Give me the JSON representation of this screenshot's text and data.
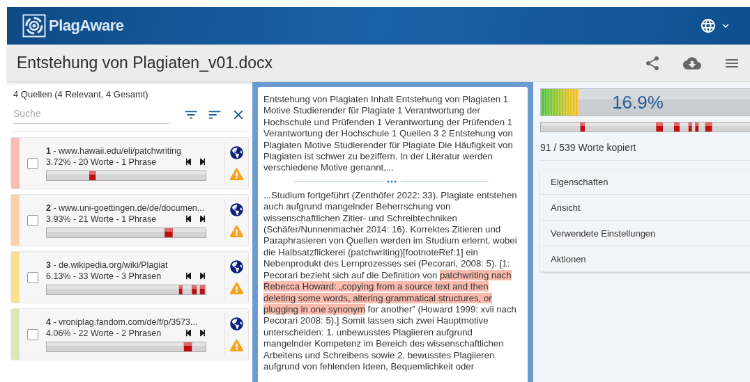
{
  "header": {
    "logo_text": "PlagAware"
  },
  "document": {
    "title": "Entstehung von Plagiaten_v01.docx"
  },
  "sources_panel": {
    "summary": "4 Quellen (4 Relevant, 4 Gesamt)",
    "search": {
      "placeholder": "Suche"
    },
    "sources": [
      {
        "title": "**1** - www.hawaii.edu/eli/patchwriting",
        "stats": "3.72% - 20 Worte - 1 Phrase",
        "color": "#f9bdb4",
        "checked": false
      },
      {
        "title": "**2** - www.uni-goettingen.de/de/documen...",
        "stats": "3.93% - 21 Worte - 1 Phrase",
        "color": "#fbd0a6",
        "checked": false
      },
      {
        "title": "**3** - de.wikipedia.org/wiki/Plagiat",
        "stats": "6.13% - 33 Worte - 3 Phrasen",
        "color": "#fde08a",
        "checked": false
      },
      {
        "title": "**4** - vroniplag.fandom.com/de/f/p/3573...",
        "stats": "4.06% - 22 Worte - 2 Phrasen",
        "color": "#d9e8b4",
        "checked": false
      }
    ]
  },
  "text_panel": {
    "excerpts": [
      {
        "segments": [
          {
            "text": "Entstehung von Plagiaten Inhalt Entstehung von Plagiaten 1 Motive Studierender für Plagiate 1 Verantwortung der Hochschule und Prüfenden 1 Verantwortung der Prüfenden 1 Verantwortung der Hochschule 1 Quellen 3 2 Entstehung von Plagiaten Motive Studierender für Plagiate Die Häufigkeit von Plagiaten ist schwer zu beziffern. In der Literatur werden verschiedene Motive genannt,...",
            "highlighted": false
          }
        ]
      },
      {
        "segments": [
          {
            "text": "...Studium fortgeführt (Zenthöfer 2022: 33). Plagiate entstehen auch aufgrund mangelnder Beherrschung von wissenschaftlichen Zitier- und Schreibtechniken (Schäfer/Nunnenmacher 2014: 16). Korrektes Zitieren und Paraphrasieren von Quellen werden im Studium erlernt, wobei die Halbsatzflickerei (patchwriting)[footnoteRef:1] ein Nebenprodukt des Lernprozesses sei (Pecorari, 2008: 5). [1: Pecorari bezieht sich auf die Definition von ",
            "highlighted": false
          },
          {
            "text": "patchwriting nach Rebecca Howard: „copying from a source text and then deleting some words, altering grammatical structures, or plugging in one synonym",
            "highlighted": true
          },
          {
            "text": " for another” (Howard 1999: xvii nach Pecorari 2008: 5).] Somit lassen sich zwei Hauptmotive unterscheiden: 1. unbewusstes Plagiieren aufgrund mangelnder Kompetenz im Bereich des wissenschaftlichen Arbeitens und Schreibens sowie 2. bewusstes Plagiieren aufgrund von fehlenden Ideen, Bequemlichkeit oder",
            "highlighted": false
          }
        ]
      }
    ]
  },
  "result_panel": {
    "score": "16.9%",
    "level": 0.169,
    "words_copied": "91 / 539 Worte kopiert",
    "sections": [
      {
        "label": "Eigenschaften"
      },
      {
        "label": "Ansicht"
      },
      {
        "label": "Verwendete Einstellungen"
      },
      {
        "label": "Aktionen"
      }
    ]
  }
}
